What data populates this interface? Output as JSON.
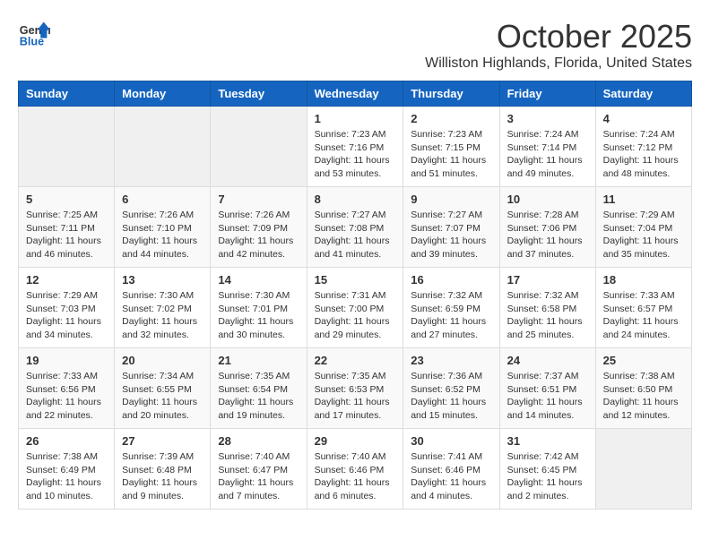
{
  "header": {
    "logo": {
      "line1": "General",
      "line2": "Blue"
    },
    "month": "October 2025",
    "location": "Williston Highlands, Florida, United States"
  },
  "weekdays": [
    "Sunday",
    "Monday",
    "Tuesday",
    "Wednesday",
    "Thursday",
    "Friday",
    "Saturday"
  ],
  "weeks": [
    [
      {
        "day": "",
        "info": ""
      },
      {
        "day": "",
        "info": ""
      },
      {
        "day": "",
        "info": ""
      },
      {
        "day": "1",
        "sunrise": "7:23 AM",
        "sunset": "7:16 PM",
        "daylight": "11 hours and 53 minutes."
      },
      {
        "day": "2",
        "sunrise": "7:23 AM",
        "sunset": "7:15 PM",
        "daylight": "11 hours and 51 minutes."
      },
      {
        "day": "3",
        "sunrise": "7:24 AM",
        "sunset": "7:14 PM",
        "daylight": "11 hours and 49 minutes."
      },
      {
        "day": "4",
        "sunrise": "7:24 AM",
        "sunset": "7:12 PM",
        "daylight": "11 hours and 48 minutes."
      }
    ],
    [
      {
        "day": "5",
        "sunrise": "7:25 AM",
        "sunset": "7:11 PM",
        "daylight": "11 hours and 46 minutes."
      },
      {
        "day": "6",
        "sunrise": "7:26 AM",
        "sunset": "7:10 PM",
        "daylight": "11 hours and 44 minutes."
      },
      {
        "day": "7",
        "sunrise": "7:26 AM",
        "sunset": "7:09 PM",
        "daylight": "11 hours and 42 minutes."
      },
      {
        "day": "8",
        "sunrise": "7:27 AM",
        "sunset": "7:08 PM",
        "daylight": "11 hours and 41 minutes."
      },
      {
        "day": "9",
        "sunrise": "7:27 AM",
        "sunset": "7:07 PM",
        "daylight": "11 hours and 39 minutes."
      },
      {
        "day": "10",
        "sunrise": "7:28 AM",
        "sunset": "7:06 PM",
        "daylight": "11 hours and 37 minutes."
      },
      {
        "day": "11",
        "sunrise": "7:29 AM",
        "sunset": "7:04 PM",
        "daylight": "11 hours and 35 minutes."
      }
    ],
    [
      {
        "day": "12",
        "sunrise": "7:29 AM",
        "sunset": "7:03 PM",
        "daylight": "11 hours and 34 minutes."
      },
      {
        "day": "13",
        "sunrise": "7:30 AM",
        "sunset": "7:02 PM",
        "daylight": "11 hours and 32 minutes."
      },
      {
        "day": "14",
        "sunrise": "7:30 AM",
        "sunset": "7:01 PM",
        "daylight": "11 hours and 30 minutes."
      },
      {
        "day": "15",
        "sunrise": "7:31 AM",
        "sunset": "7:00 PM",
        "daylight": "11 hours and 29 minutes."
      },
      {
        "day": "16",
        "sunrise": "7:32 AM",
        "sunset": "6:59 PM",
        "daylight": "11 hours and 27 minutes."
      },
      {
        "day": "17",
        "sunrise": "7:32 AM",
        "sunset": "6:58 PM",
        "daylight": "11 hours and 25 minutes."
      },
      {
        "day": "18",
        "sunrise": "7:33 AM",
        "sunset": "6:57 PM",
        "daylight": "11 hours and 24 minutes."
      }
    ],
    [
      {
        "day": "19",
        "sunrise": "7:33 AM",
        "sunset": "6:56 PM",
        "daylight": "11 hours and 22 minutes."
      },
      {
        "day": "20",
        "sunrise": "7:34 AM",
        "sunset": "6:55 PM",
        "daylight": "11 hours and 20 minutes."
      },
      {
        "day": "21",
        "sunrise": "7:35 AM",
        "sunset": "6:54 PM",
        "daylight": "11 hours and 19 minutes."
      },
      {
        "day": "22",
        "sunrise": "7:35 AM",
        "sunset": "6:53 PM",
        "daylight": "11 hours and 17 minutes."
      },
      {
        "day": "23",
        "sunrise": "7:36 AM",
        "sunset": "6:52 PM",
        "daylight": "11 hours and 15 minutes."
      },
      {
        "day": "24",
        "sunrise": "7:37 AM",
        "sunset": "6:51 PM",
        "daylight": "11 hours and 14 minutes."
      },
      {
        "day": "25",
        "sunrise": "7:38 AM",
        "sunset": "6:50 PM",
        "daylight": "11 hours and 12 minutes."
      }
    ],
    [
      {
        "day": "26",
        "sunrise": "7:38 AM",
        "sunset": "6:49 PM",
        "daylight": "11 hours and 10 minutes."
      },
      {
        "day": "27",
        "sunrise": "7:39 AM",
        "sunset": "6:48 PM",
        "daylight": "11 hours and 9 minutes."
      },
      {
        "day": "28",
        "sunrise": "7:40 AM",
        "sunset": "6:47 PM",
        "daylight": "11 hours and 7 minutes."
      },
      {
        "day": "29",
        "sunrise": "7:40 AM",
        "sunset": "6:46 PM",
        "daylight": "11 hours and 6 minutes."
      },
      {
        "day": "30",
        "sunrise": "7:41 AM",
        "sunset": "6:46 PM",
        "daylight": "11 hours and 4 minutes."
      },
      {
        "day": "31",
        "sunrise": "7:42 AM",
        "sunset": "6:45 PM",
        "daylight": "11 hours and 2 minutes."
      },
      {
        "day": "",
        "info": ""
      }
    ]
  ],
  "labels": {
    "sunrise": "Sunrise:",
    "sunset": "Sunset:",
    "daylight": "Daylight:"
  }
}
